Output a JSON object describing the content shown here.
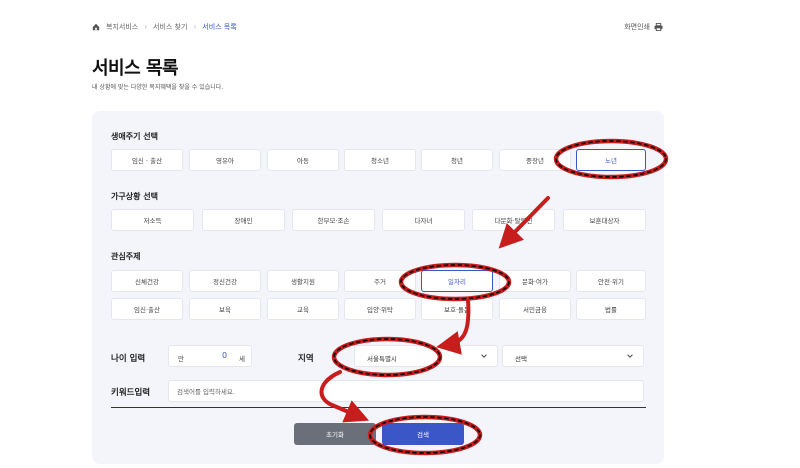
{
  "breadcrumb": {
    "home_icon": "home-icon",
    "items": [
      "복지서비스",
      "서비스 찾기",
      "서비스 목록"
    ]
  },
  "print": {
    "label": "화면인쇄",
    "icon": "printer-icon"
  },
  "page": {
    "title": "서비스 목록",
    "subtitle": "내 상황에 맞는 다양한 복지혜택을 찾을 수 있습니다."
  },
  "life_cycle": {
    "title": "생애주기 선택",
    "options": [
      "임신 · 출산",
      "영유아",
      "아동",
      "청소년",
      "청년",
      "중장년",
      "노년"
    ],
    "selected": "노년"
  },
  "household": {
    "title": "가구상황 선택",
    "options": [
      "저소득",
      "장애인",
      "한부모·조손",
      "다자녀",
      "다문화·탈북민",
      "보훈대상자"
    ]
  },
  "interest": {
    "title": "관심주제",
    "row1": [
      "신체건강",
      "정신건강",
      "생활지원",
      "주거",
      "일자리",
      "문화·여가",
      "안전·위기"
    ],
    "row2": [
      "임신·출산",
      "보육",
      "교육",
      "입양·위탁",
      "보호·돌봄",
      "서민금융",
      "법률"
    ],
    "selected": "일자리"
  },
  "age": {
    "label": "나이 입력",
    "prefix": "만",
    "value": "0",
    "suffix": "세"
  },
  "region": {
    "label": "지역",
    "sido": "서울특별시",
    "sigungu": "선택"
  },
  "keyword": {
    "label": "키워드입력",
    "placeholder": "검색어를 입력하세요."
  },
  "buttons": {
    "reset": "초기화",
    "search": "검색"
  },
  "colors": {
    "accent": "#3a56c7",
    "annotation": "#c81d1d",
    "panel_bg": "#f3f5fa"
  }
}
